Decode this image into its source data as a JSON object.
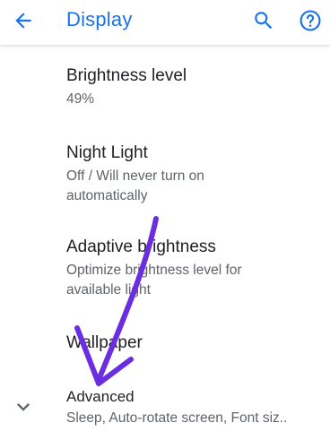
{
  "app_bar": {
    "title": "Display",
    "back_icon": "arrow-back-icon",
    "search_icon": "search-icon",
    "help_icon": "help-icon"
  },
  "colors": {
    "accent": "#1a73e8",
    "annotation_arrow": "#6a2ee0",
    "primary_text": "#202124",
    "secondary_text": "#5f6368"
  },
  "preferences": [
    {
      "title": "Brightness level",
      "summary": "49%"
    },
    {
      "title": "Night Light",
      "summary": "Off / Will never turn on automatically"
    },
    {
      "title": "Adaptive brightness",
      "summary": "Optimize brightness level for available light"
    },
    {
      "title": "Wallpaper",
      "summary": ""
    },
    {
      "title": "Advanced",
      "summary": "Sleep, Auto-rotate screen, Font siz.."
    }
  ],
  "advanced_expand_icon": "chevron-down-icon"
}
